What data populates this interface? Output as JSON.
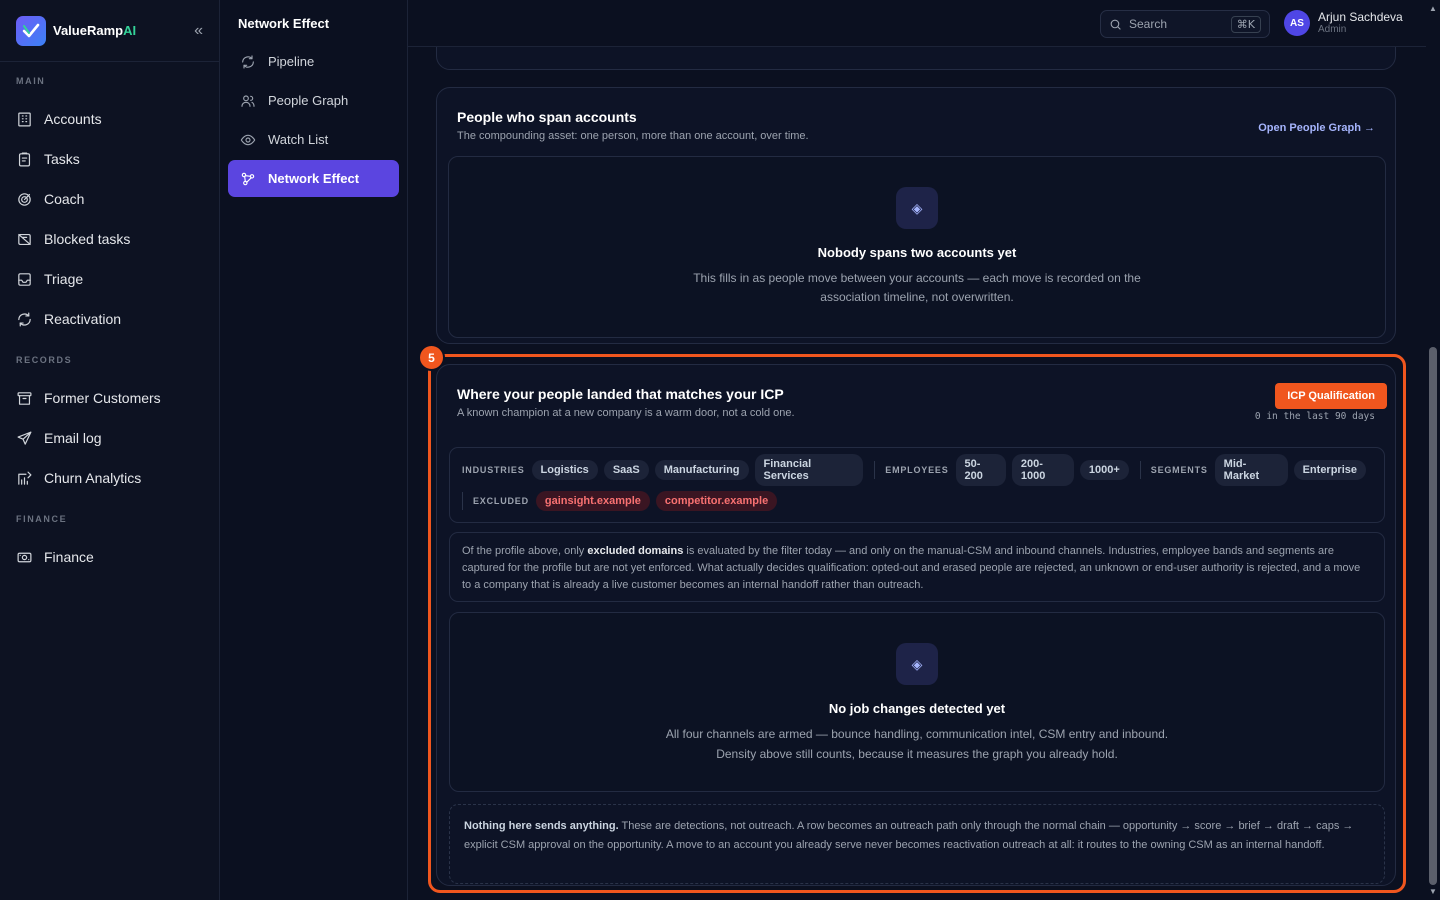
{
  "brand": {
    "name": "ValueRamp",
    "suffix": "AI"
  },
  "sidebar": {
    "sections": {
      "main": "MAIN",
      "records": "RECORDS",
      "finance": "FINANCE"
    },
    "main_items": [
      {
        "label": "Accounts",
        "icon": "building-icon"
      },
      {
        "label": "Tasks",
        "icon": "clipboard-icon"
      },
      {
        "label": "Coach",
        "icon": "target-icon"
      },
      {
        "label": "Blocked tasks",
        "icon": "blocked-icon"
      },
      {
        "label": "Triage",
        "icon": "inbox-icon"
      },
      {
        "label": "Reactivation",
        "icon": "refresh-icon"
      }
    ],
    "record_items": [
      {
        "label": "Former Customers",
        "icon": "archive-icon"
      },
      {
        "label": "Email log",
        "icon": "send-icon"
      },
      {
        "label": "Churn Analytics",
        "icon": "chart-icon"
      }
    ],
    "finance_items": [
      {
        "label": "Finance",
        "icon": "money-icon"
      }
    ]
  },
  "subnav": {
    "title": "Network Effect",
    "items": [
      {
        "label": "Pipeline",
        "icon": "refresh-icon"
      },
      {
        "label": "People Graph",
        "icon": "people-icon"
      },
      {
        "label": "Watch List",
        "icon": "eye-icon"
      },
      {
        "label": "Network Effect",
        "icon": "network-icon",
        "active": true
      }
    ]
  },
  "topbar": {
    "search_placeholder": "Search",
    "search_shortcut": "⌘K",
    "user_initials": "AS",
    "user_name": "Arjun Sachdeva",
    "user_role": "Admin"
  },
  "people_span": {
    "title": "People who span accounts",
    "subtitle": "The compounding asset: one person, more than one account, over time.",
    "link": "Open People Graph →",
    "empty_title": "Nobody spans two accounts yet",
    "empty_line1": "This fills in as people move between your accounts — each move is recorded on the",
    "empty_line2": "association timeline, not overwritten."
  },
  "icp": {
    "step": "5",
    "button": "ICP Qualification",
    "window_note": "0 in the last 90 days",
    "title": "Where your people landed that matches your ICP",
    "subtitle": "A known champion at a new company is a warm door, not a cold one.",
    "filters": {
      "industries_label": "INDUSTRIES",
      "industries": [
        "Logistics",
        "SaaS",
        "Manufacturing",
        "Financial Services"
      ],
      "employees_label": "EMPLOYEES",
      "employees": [
        "50-200",
        "200-1000",
        "1000+"
      ],
      "segments_label": "SEGMENTS",
      "segments": [
        "Mid-Market",
        "Enterprise"
      ],
      "excluded_label": "EXCLUDED",
      "excluded": [
        "gainsight.example",
        "competitor.example"
      ]
    },
    "profile_note_pre": "Of the profile above, only ",
    "profile_note_bold": "excluded domains",
    "profile_note_post": " is evaluated by the filter today — and only on the manual-CSM and inbound channels. Industries, employee bands and segments are captured for the profile but are not yet enforced. What actually decides qualification: opted-out and erased people are rejected, an unknown or end-user authority is rejected, and a move to a company that is already a live customer becomes an internal handoff rather than outreach.",
    "empty_title": "No job changes detected yet",
    "empty_line1": "All four channels are armed — bounce handling, communication intel, CSM entry and inbound.",
    "empty_line2": "Density above still counts, because it measures the graph you already hold.",
    "footer_bold": "Nothing here sends anything.",
    "footer_text": " These are detections, not outreach. A row becomes an outreach path only through the normal chain — opportunity → score → brief → draft → caps → explicit CSM approval on the opportunity. A move to an account you already serve never becomes reactivation outreach at all: it routes to the owning CSM as an internal handoff."
  },
  "colors": {
    "accent": "#5b45e0",
    "highlight": "#f0561e",
    "background": "#0b1020"
  }
}
